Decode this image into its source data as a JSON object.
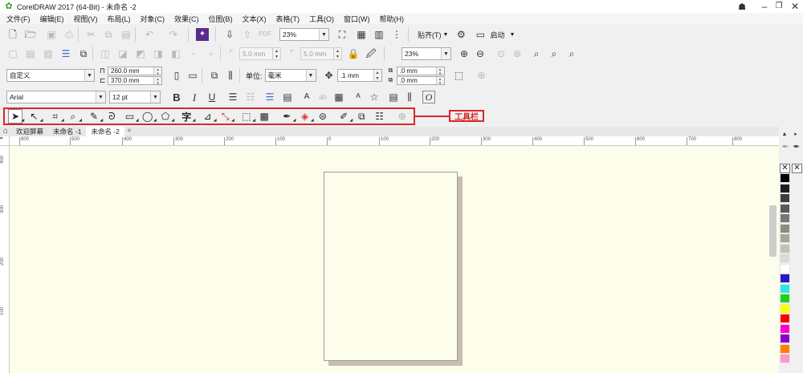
{
  "title_bar": {
    "app_title": "CorelDRAW 2017 (64-Bit) - 未命名 -2"
  },
  "menu": [
    "文件(F)",
    "编辑(E)",
    "视图(V)",
    "布局(L)",
    "对象(C)",
    "效果(C)",
    "位图(B)",
    "文本(X)",
    "表格(T)",
    "工具(O)",
    "窗口(W)",
    "帮助(H)"
  ],
  "standard_toolbar": {
    "zoom": "23%",
    "snap_label": "贴齐(T)",
    "launch_label": "启动"
  },
  "row2": {
    "nudge1": "5.0 mm",
    "nudge2": "5.0 mm",
    "zoom": "23%"
  },
  "property_bar": {
    "page_preset": "自定义",
    "width": "260.0 mm",
    "height": "370.0 mm",
    "units_label": "单位:",
    "units_value": "毫米",
    "nudge": ".1 mm",
    "dup_x": ".0 mm",
    "dup_y": ".0 mm"
  },
  "text_bar": {
    "font": "Arial",
    "size": "12 pt"
  },
  "annotation": {
    "label": "工具栏",
    "color": "#d62828"
  },
  "doc_tabs": [
    {
      "label": "欢迎屏幕"
    },
    {
      "label": "未命名 -1"
    },
    {
      "label": "未命名 -2"
    }
  ],
  "ruler": {
    "unit": "毫米",
    "h_ticks": [
      "800",
      "500",
      "400",
      "300",
      "200",
      "100",
      "0",
      "100",
      "200",
      "300",
      "400",
      "500",
      "600",
      "700",
      "800"
    ],
    "v_ticks": [
      "400",
      "300",
      "200",
      "100"
    ]
  },
  "palette": {
    "colors": [
      "#000000",
      "#1f1f1f",
      "#3d3d3d",
      "#595959",
      "#767676",
      "#8e8a80",
      "#aaa59a",
      "#c5c0b4",
      "#ddd9ce",
      "#ffffff",
      "#2418c8",
      "#2ce6e6",
      "#1bd21b",
      "#ffff00",
      "#ff0000",
      "#ff00c8",
      "#8b00c8",
      "#ff8000",
      "#ff96c8"
    ]
  }
}
